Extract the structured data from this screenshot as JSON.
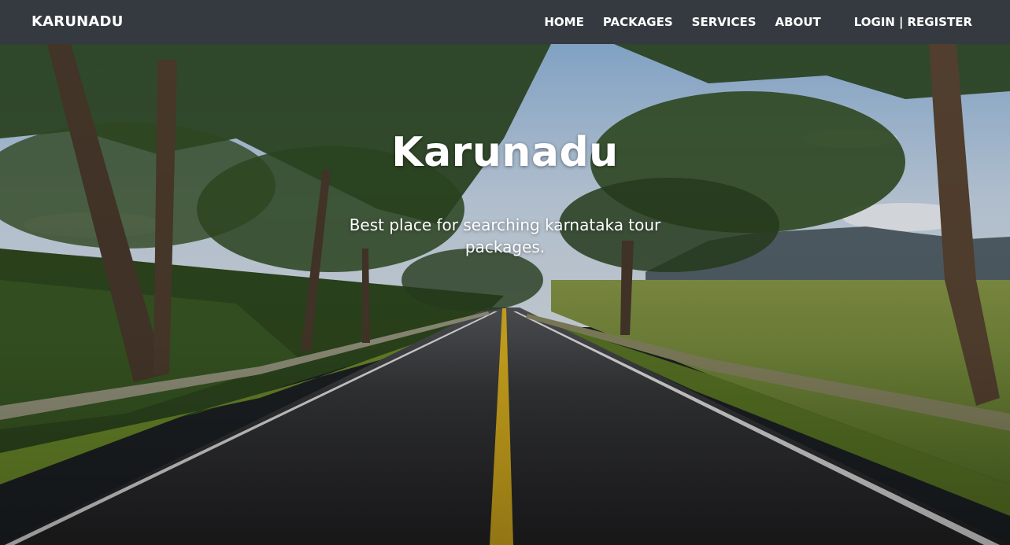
{
  "nav": {
    "brand": "KARUNADU",
    "links": [
      {
        "label": "HOME"
      },
      {
        "label": "PACKAGES"
      },
      {
        "label": "SERVICES"
      },
      {
        "label": "ABOUT"
      }
    ],
    "login_label": "LOGIN",
    "separator": "|",
    "register_label": "REGISTER"
  },
  "hero": {
    "title": "Karunadu",
    "subtitle": "Best place for searching karnataka tour packages."
  },
  "colors": {
    "navbar_bg": "#343a40",
    "text": "#ffffff",
    "road": "#2b2b2e",
    "center_line": "#e0b520",
    "sky": "#b9cfe6",
    "foliage": "#3e5a26"
  }
}
